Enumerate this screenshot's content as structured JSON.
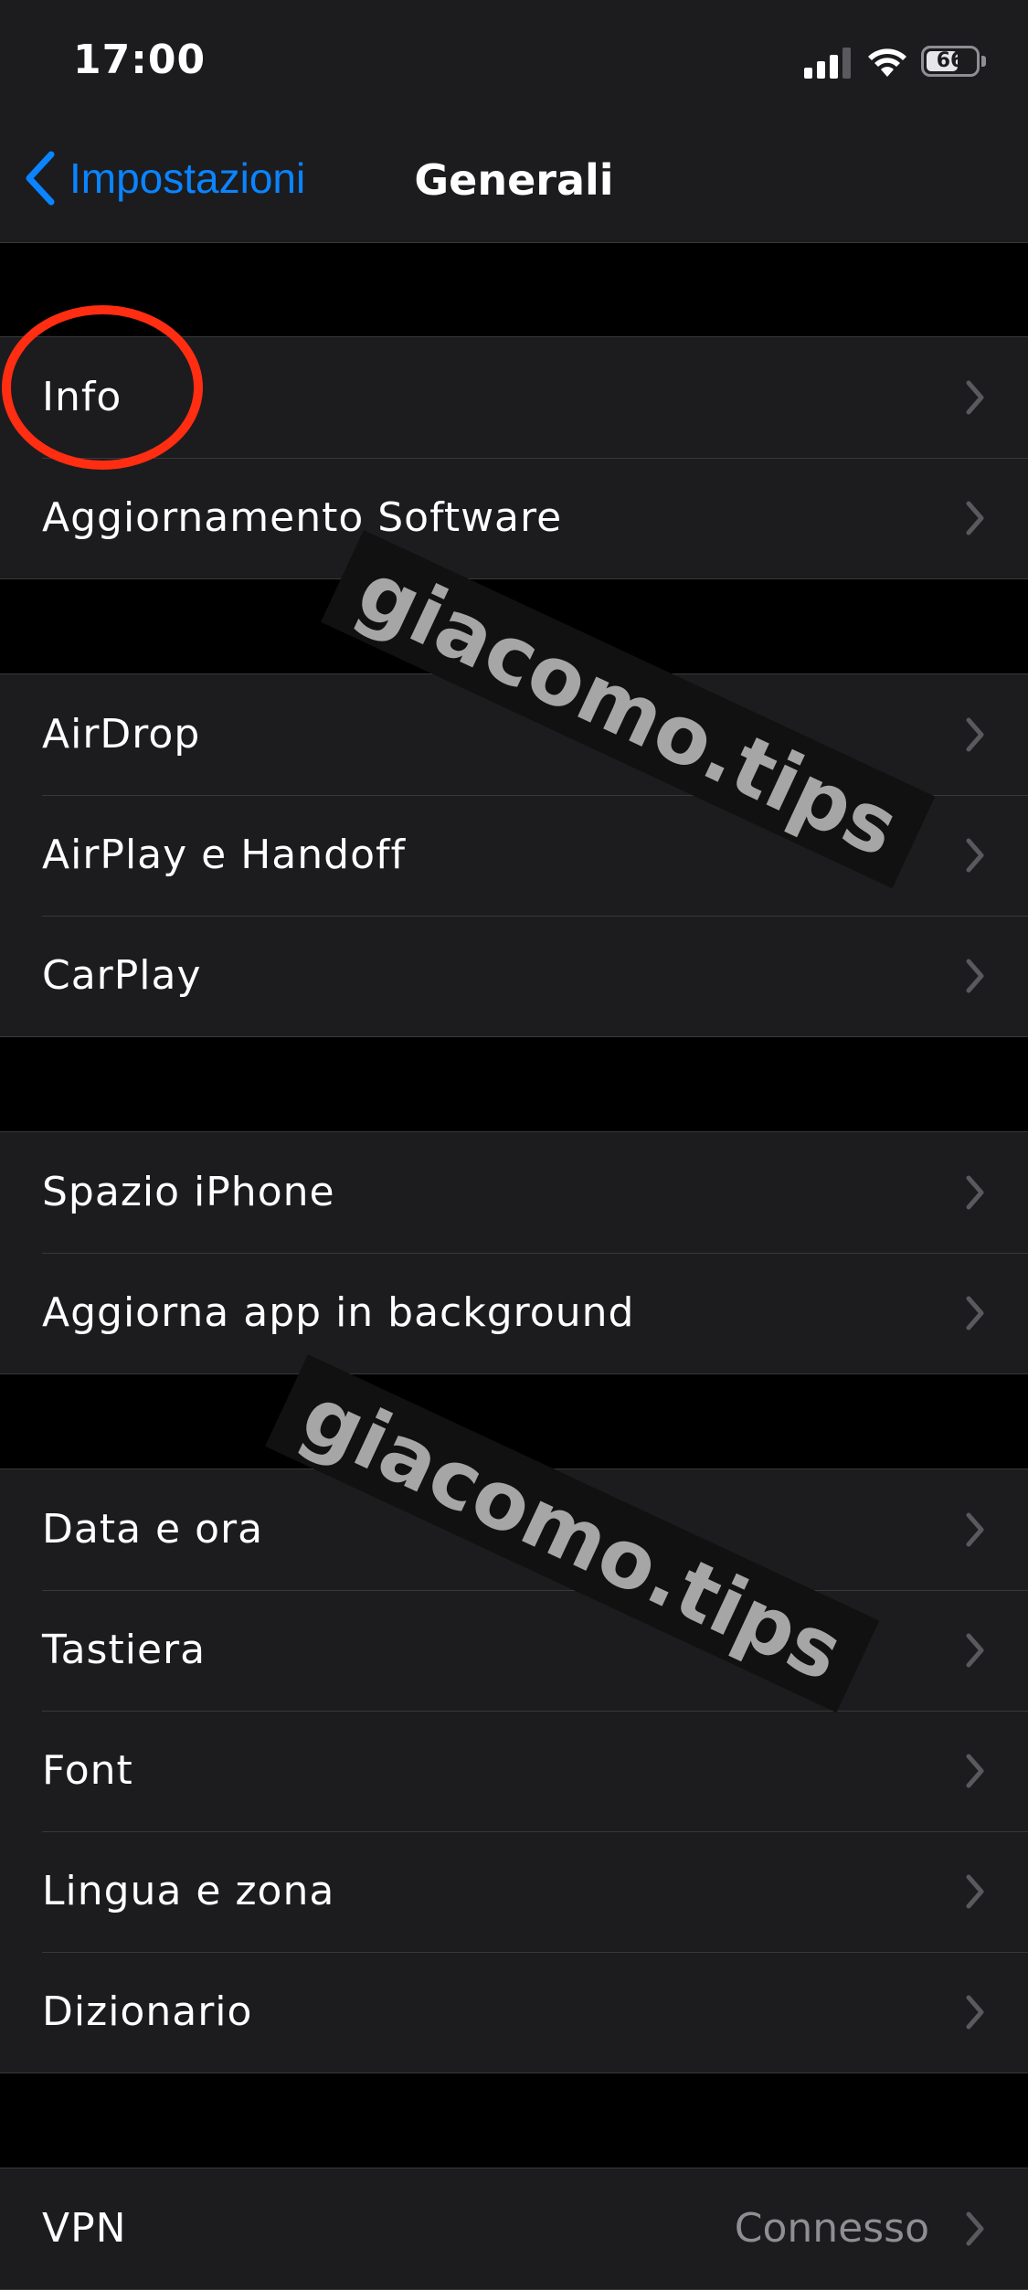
{
  "status_bar": {
    "time": "17:00",
    "battery_level": "66",
    "battery_fraction": 0.66
  },
  "nav": {
    "back_label": "Impostazioni",
    "title": "Generali"
  },
  "groups": [
    {
      "items": [
        {
          "label": "Info"
        },
        {
          "label": "Aggiornamento Software"
        }
      ]
    },
    {
      "items": [
        {
          "label": "AirDrop"
        },
        {
          "label": "AirPlay e Handoff"
        },
        {
          "label": "CarPlay"
        }
      ]
    },
    {
      "items": [
        {
          "label": "Spazio iPhone"
        },
        {
          "label": "Aggiorna app in background"
        }
      ]
    },
    {
      "items": [
        {
          "label": "Data e ora"
        },
        {
          "label": "Tastiera"
        },
        {
          "label": "Font"
        },
        {
          "label": "Lingua e zona"
        },
        {
          "label": "Dizionario"
        }
      ]
    },
    {
      "items": [
        {
          "label": "VPN",
          "value": "Connesso"
        }
      ]
    }
  ],
  "watermark_text": "giacomo.tips",
  "colors": {
    "accent": "#0a84ff",
    "annotation": "#ff2d12",
    "group_bg": "#1c1c1e",
    "page_bg": "#000000"
  },
  "icons": [
    "signal-icon",
    "wifi-icon",
    "battery-icon",
    "chevron-left-icon",
    "chevron-right-icon"
  ]
}
